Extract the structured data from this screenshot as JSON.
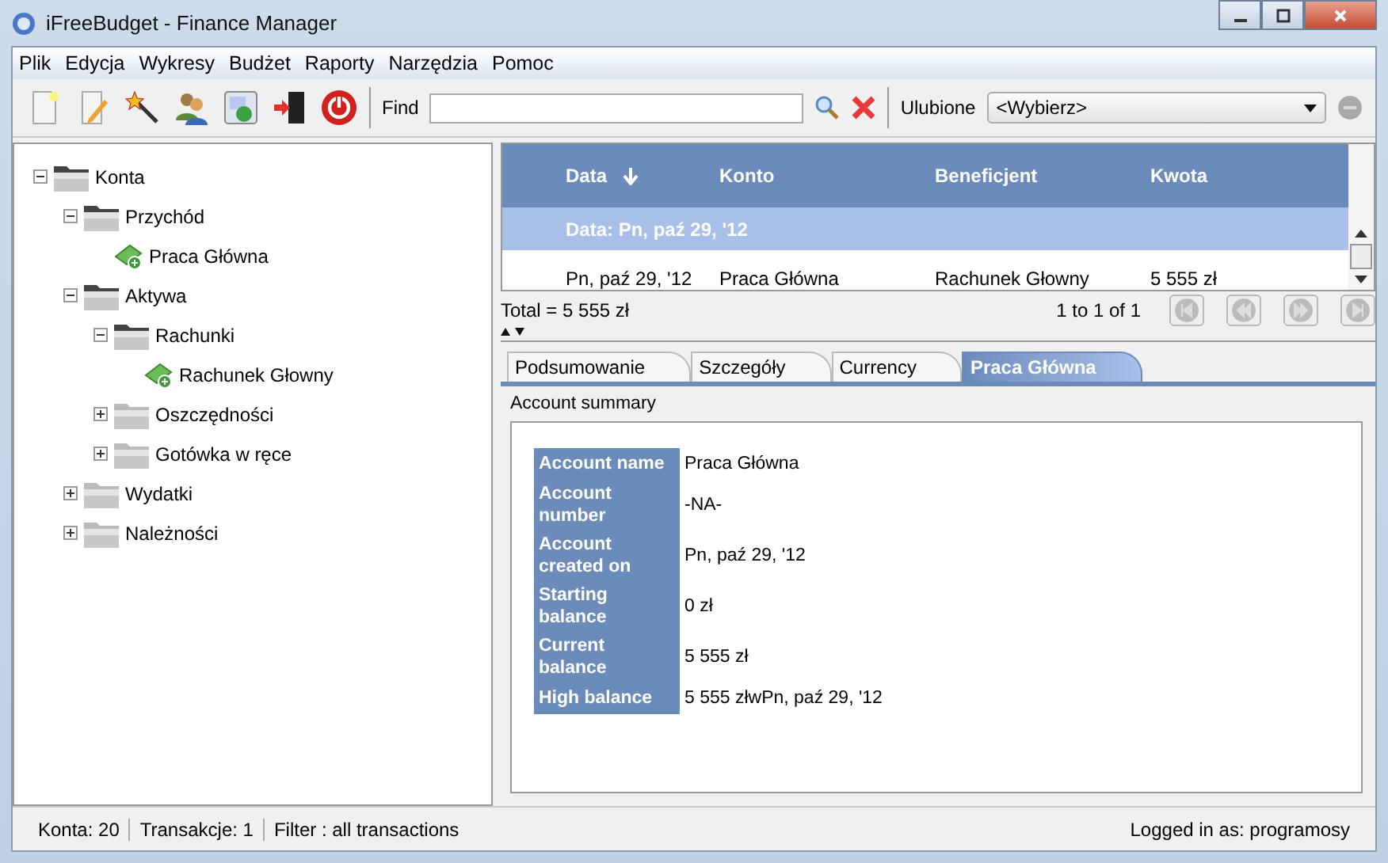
{
  "window": {
    "title": "iFreeBudget - Finance Manager"
  },
  "menu": [
    {
      "label": "Plik"
    },
    {
      "label": "Edycja"
    },
    {
      "label": "Wykresy"
    },
    {
      "label": "Budżet"
    },
    {
      "label": "Raporty"
    },
    {
      "label": "Narzędzia"
    },
    {
      "label": "Pomoc"
    }
  ],
  "toolbar": {
    "find_label": "Find",
    "favorites_label": "Ulubione",
    "favorites_value": "<Wybierz>"
  },
  "tree": [
    {
      "label": "Konta",
      "kind": "folder",
      "expanded": true,
      "children": [
        {
          "label": "Przychód",
          "kind": "folder",
          "expanded": true,
          "children": [
            {
              "label": "Praca Główna",
              "kind": "account"
            }
          ]
        },
        {
          "label": "Aktywa",
          "kind": "folder",
          "expanded": true,
          "children": [
            {
              "label": "Rachunki",
              "kind": "folder",
              "expanded": true,
              "children": [
                {
                  "label": "Rachunek Głowny",
                  "kind": "account"
                }
              ]
            },
            {
              "label": "Oszczędności",
              "kind": "folder",
              "expanded": false
            },
            {
              "label": "Gotówka w ręce",
              "kind": "folder",
              "expanded": false
            }
          ]
        },
        {
          "label": "Wydatki",
          "kind": "folder",
          "expanded": false
        },
        {
          "label": "Należności",
          "kind": "folder",
          "expanded": false
        }
      ]
    }
  ],
  "table": {
    "columns": [
      {
        "label": "Data",
        "sorted": true
      },
      {
        "label": "Konto",
        "sorted": false
      },
      {
        "label": "Beneficjent",
        "sorted": false
      },
      {
        "label": "Kwota",
        "sorted": false
      }
    ],
    "group": "Data: Pn, paź 29, '12",
    "rows": [
      [
        "Pn, paź 29, '12",
        "Praca Główna",
        "Rachunek Głowny",
        "5 555 zł"
      ]
    ],
    "total": "Total = 5 555 zł",
    "page_info": "1 to 1 of 1"
  },
  "tabs": [
    {
      "label": "Podsumowanie",
      "selected": false
    },
    {
      "label": "Szczegóły",
      "selected": false
    },
    {
      "label": "Currency",
      "selected": false
    },
    {
      "label": "Praca Główna",
      "selected": true
    }
  ],
  "summary": {
    "title": "Account summary",
    "rows": [
      {
        "label": "Account name",
        "value": "Praca Główna"
      },
      {
        "label": "Account number",
        "value": "-NA-"
      },
      {
        "label": "Account created on",
        "value": "Pn, paź 29, '12"
      },
      {
        "label": "Starting balance",
        "value": "0 zł"
      },
      {
        "label": "Current balance",
        "value": "5 555 zł"
      },
      {
        "label": "High balance",
        "value": "5 555 złwPn, paź 29, '12"
      }
    ]
  },
  "status_bar": [
    "Konta: 20",
    "Transakcje: 1",
    "Filter : all transactions"
  ],
  "status_right": "Logged in as: programosy"
}
